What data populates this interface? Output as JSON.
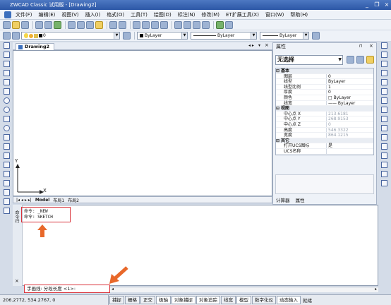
{
  "window": {
    "title": "ZWCAD Classic 试用版 - [Drawing2]",
    "minimize": "_",
    "restore": "❐",
    "close": "×"
  },
  "menu": [
    "文件(F)",
    "编辑(E)",
    "视图(V)",
    "插入(I)",
    "格式(O)",
    "工具(T)",
    "绘图(D)",
    "标注(N)",
    "修改(M)",
    "ET扩展工具(X)",
    "窗口(W)",
    "帮助(H)"
  ],
  "toolbar": {
    "layer_value": "0",
    "color_value": "ByLayer",
    "linetype_value": "ByLayer",
    "lineweight_value": "ByLayer"
  },
  "drawing": {
    "tab_label": "Drawing2",
    "axis_y": "Y",
    "axis_x": "X"
  },
  "layout_tabs": [
    "Model",
    "布局1",
    "布局2"
  ],
  "panel": {
    "title": "属性",
    "selection": "无选择",
    "rows": [
      {
        "k": "基本",
        "v": "",
        "cat": true
      },
      {
        "k": "图层",
        "v": "0"
      },
      {
        "k": "线型",
        "v": "ByLayer"
      },
      {
        "k": "线型比例",
        "v": "1"
      },
      {
        "k": "厚度",
        "v": "0"
      },
      {
        "k": "颜色",
        "v": "□ ByLayer"
      },
      {
        "k": "线宽",
        "v": "—— ByLayer"
      },
      {
        "k": "视图",
        "v": "",
        "cat": true
      },
      {
        "k": "中心点 X",
        "v": "213.6181",
        "dim": true
      },
      {
        "k": "中心点 Y",
        "v": "268.9153",
        "dim": true
      },
      {
        "k": "中心点 Z",
        "v": "0",
        "dim": true
      },
      {
        "k": "高度",
        "v": "546.3322",
        "dim": true
      },
      {
        "k": "宽度",
        "v": "864.1215",
        "dim": true
      },
      {
        "k": "其它",
        "v": "",
        "cat": true
      },
      {
        "k": "打开UCS图标",
        "v": "是"
      },
      {
        "k": "UCS名称",
        "v": ""
      }
    ],
    "tabs": [
      "计算器",
      "属性"
    ]
  },
  "command": {
    "history": [
      "命令: _NEW",
      "命令: SKETCH"
    ],
    "prompt": "手画线:  分段长度 <1>:",
    "side_label": "命令行"
  },
  "status": {
    "coords": "206.2772,  534.2767,  0",
    "buttons": [
      "捕捉",
      "栅格",
      "正交",
      "极轴",
      "对象捕捉",
      "对象追踪",
      "线宽",
      "模型",
      "数字化仪",
      "动态输入",
      "就绪"
    ]
  }
}
